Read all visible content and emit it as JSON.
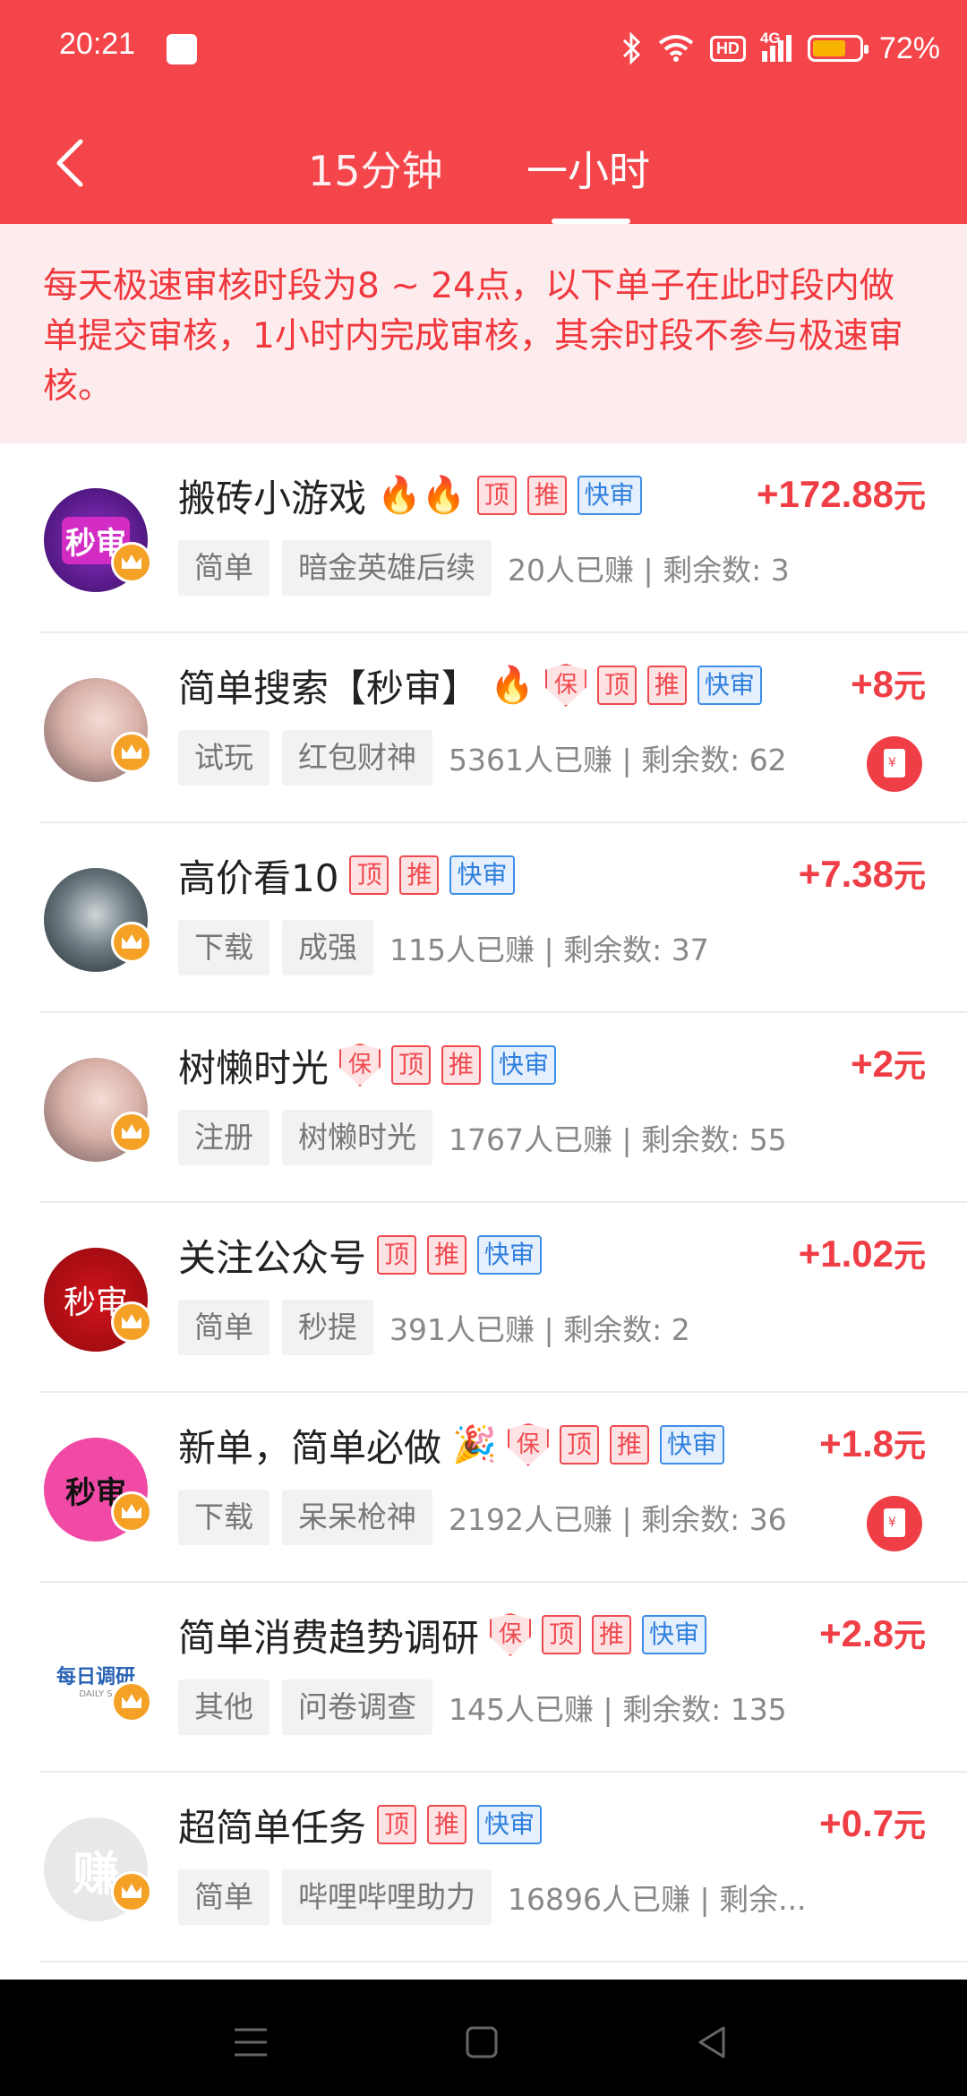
{
  "status": {
    "time": "20:21",
    "hd": "HD",
    "network": "4G",
    "battery": "72%",
    "battery_level": 0.72
  },
  "header": {
    "tabs": [
      {
        "label": "15分钟"
      },
      {
        "label": "一小时"
      }
    ],
    "active_tab": "一小时"
  },
  "notice": {
    "text": "每天极速审核时段为8 ~ 24点，以下单子在此时段内做单提交审核，1小时内完成审核，其余时段不参与极速审核。"
  },
  "badges": {
    "top": "顶",
    "push": "推",
    "fast": "快审",
    "guarantee": "保"
  },
  "currency": "元",
  "items": [
    {
      "title": "搬砖小游戏",
      "emoji": "🔥🔥",
      "price": "+172.88",
      "tags": [
        "简单",
        "暗金英雄后续"
      ],
      "stat": "20人已赚 | 剩余数: 3",
      "avatar_text": "秒审"
    },
    {
      "title": "简单搜索【秒审】",
      "emoji": "🔥",
      "price": "+8",
      "tags": [
        "试玩",
        "红包财神"
      ],
      "stat": "5361人已赚 | 剩余数: 62"
    },
    {
      "title": "高价看10",
      "price": "+7.38",
      "tags": [
        "下载",
        "成强"
      ],
      "stat": "115人已赚 | 剩余数: 37"
    },
    {
      "title": "树懒时光",
      "price": "+2",
      "tags": [
        "注册",
        "树懒时光"
      ],
      "stat": "1767人已赚 | 剩余数: 55"
    },
    {
      "title": "关注公众号",
      "price": "+1.02",
      "tags": [
        "简单",
        "秒提"
      ],
      "stat": "391人已赚 | 剩余数: 2",
      "avatar_text": "秒审"
    },
    {
      "title": "新单，简单必做",
      "emoji": "🎉",
      "price": "+1.8",
      "tags": [
        "下载",
        "呆呆枪神"
      ],
      "stat": "2192人已赚 | 剩余数: 36",
      "avatar_text": "秒审"
    },
    {
      "title": "简单消费趋势调研",
      "price": "+2.8",
      "tags": [
        "其他",
        "问卷调查"
      ],
      "stat": "145人已赚 | 剩余数: 135",
      "avatar_text": "每日调研",
      "avatar_sub": "DAILY S"
    },
    {
      "title": "超简单任务",
      "price": "+0.7",
      "tags": [
        "简单",
        "哔哩哔哩助力"
      ],
      "stat": "16896人已赚 | 剩余...",
      "avatar_text": "赚"
    }
  ]
}
